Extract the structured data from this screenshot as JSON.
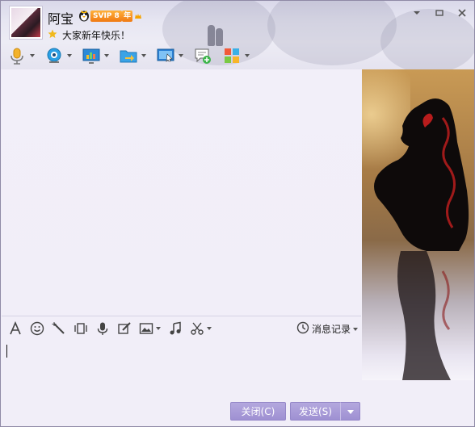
{
  "contact": {
    "nickname": "阿宝",
    "vip_label": "SVIP 8",
    "year_label": "年",
    "signature": "大家新年快乐！"
  },
  "window_controls": {
    "items": [
      {
        "name": "dropdown-icon"
      },
      {
        "name": "minimize-icon"
      },
      {
        "name": "close-icon"
      }
    ]
  },
  "toolbar": {
    "items": [
      {
        "name": "voice-call",
        "icon": "microphone-icon"
      },
      {
        "name": "video-call",
        "icon": "camera-icon"
      },
      {
        "name": "remote-desktop",
        "icon": "monitor-chart-icon"
      },
      {
        "name": "send-file",
        "icon": "folder-arrow-icon"
      },
      {
        "name": "screen-share",
        "icon": "screen-share-icon"
      },
      {
        "name": "create-discussion",
        "icon": "chat-add-icon"
      },
      {
        "name": "apps",
        "icon": "apps-grid-icon"
      }
    ]
  },
  "input_toolbar": {
    "items": [
      {
        "name": "font",
        "icon": "font-icon"
      },
      {
        "name": "emoji",
        "icon": "smiley-icon"
      },
      {
        "name": "magic-effects",
        "icon": "magic-wand-icon"
      },
      {
        "name": "shake-window",
        "icon": "shake-icon"
      },
      {
        "name": "voice-message",
        "icon": "microphone-icon"
      },
      {
        "name": "doodle",
        "icon": "pen-icon"
      },
      {
        "name": "send-image",
        "icon": "image-icon"
      },
      {
        "name": "music",
        "icon": "music-note-icon"
      },
      {
        "name": "screenshot",
        "icon": "scissors-icon"
      }
    ],
    "history_label": "消息记录"
  },
  "buttons": {
    "close_label": "关闭(C)",
    "send_label": "发送(S)"
  },
  "colors": {
    "button": "#9e90d2",
    "chat_background": "#f1eef8",
    "vip_orange": "#f07a12"
  }
}
